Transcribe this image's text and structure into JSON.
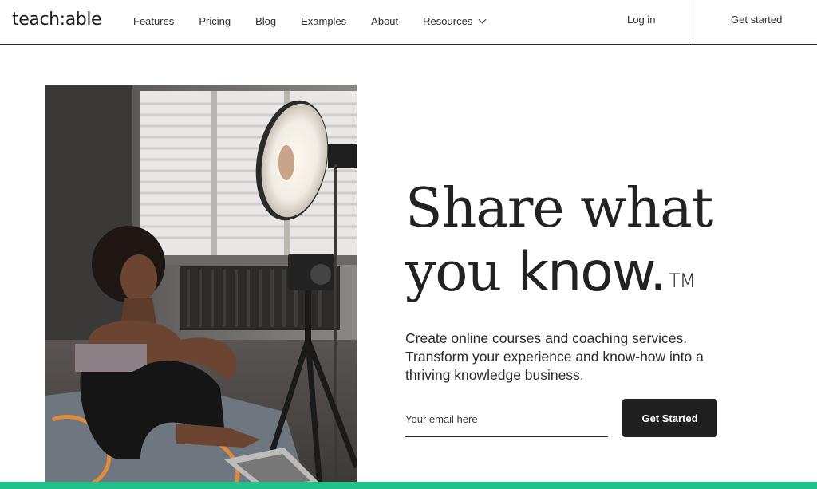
{
  "nav": {
    "logo": "teach:able",
    "links": [
      "Features",
      "Pricing",
      "Blog",
      "Examples",
      "About",
      "Resources"
    ],
    "login": "Log in",
    "get_started": "Get started"
  },
  "hero": {
    "headline_line1": "Share what",
    "headline_line2_a": "you ",
    "headline_line2_b": "know.",
    "trademark": "TM",
    "subtext": "Create online courses and coaching services. Transform your experience and know-how into a thriving knowledge business.",
    "email_placeholder": "Your email here",
    "cta_label": "Get Started"
  },
  "colors": {
    "accent_bar": "#22c08a",
    "button_bg": "#1f1f1f"
  }
}
